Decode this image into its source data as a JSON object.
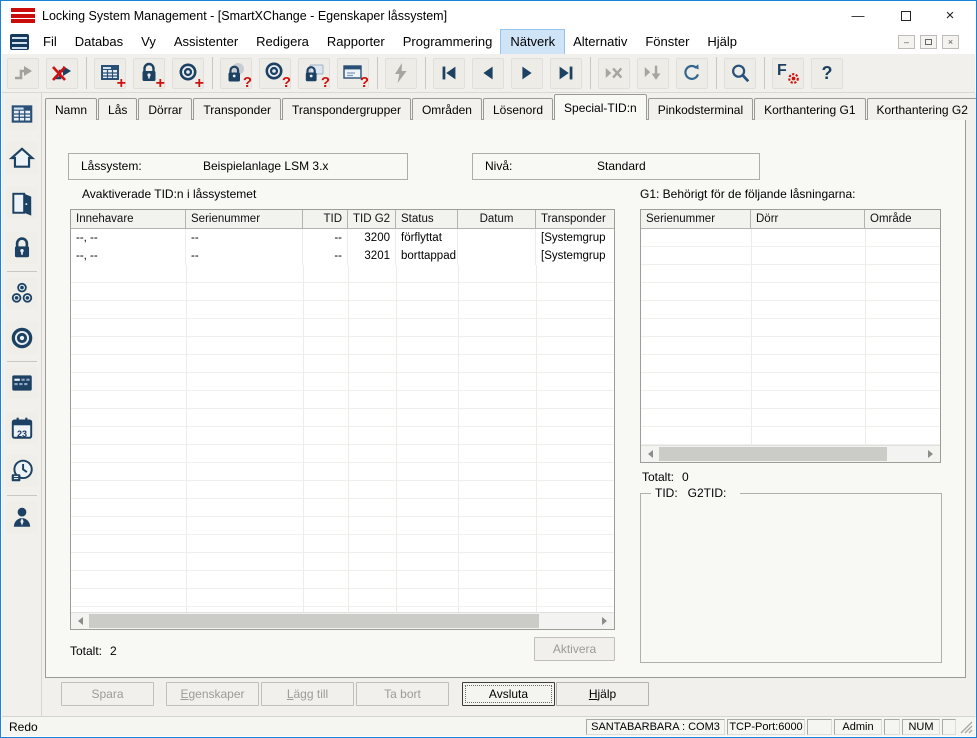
{
  "window": {
    "title": "Locking System Management - [SmartXChange - Egenskaper låssystem]",
    "minimize_glyph": "—",
    "close_glyph": "×"
  },
  "mdi": {
    "minimize_glyph": "–",
    "close_glyph": "×"
  },
  "menubar": {
    "items": [
      "Fil",
      "Databas",
      "Vy",
      "Assistenter",
      "Redigera",
      "Rapporter",
      "Programmering",
      "Nätverk",
      "Alternativ",
      "Fönster",
      "Hjälp"
    ],
    "active": "Nätverk"
  },
  "toolbar": {
    "buttons": [
      {
        "name": "jump",
        "overlay": ""
      },
      {
        "name": "jump-cancel",
        "overlay": ""
      },
      {
        "name": "new-locking-system",
        "overlay": "+"
      },
      {
        "name": "new-lock",
        "overlay": "+"
      },
      {
        "name": "new-transponder",
        "overlay": "+"
      },
      {
        "name": "read-lock",
        "overlay": "?"
      },
      {
        "name": "read-transponder",
        "overlay": "?"
      },
      {
        "name": "read-g1-lock",
        "overlay": "?"
      },
      {
        "name": "read-window",
        "overlay": "?"
      },
      {
        "name": "program",
        "overlay": ""
      },
      {
        "name": "first-record",
        "overlay": ""
      },
      {
        "name": "prev-record",
        "overlay": ""
      },
      {
        "name": "next-record",
        "overlay": ""
      },
      {
        "name": "last-record",
        "overlay": ""
      },
      {
        "name": "cancel-record",
        "overlay": ""
      },
      {
        "name": "goto-record",
        "overlay": ""
      },
      {
        "name": "refresh",
        "overlay": ""
      },
      {
        "name": "search",
        "overlay": ""
      },
      {
        "name": "filter-settings",
        "overlay": "",
        "base": "F"
      },
      {
        "name": "help",
        "overlay": "",
        "base": "?"
      }
    ]
  },
  "sidebar": {
    "icons": [
      "matrix",
      "home",
      "door",
      "lock",
      "transponder-group",
      "transponder",
      "schedule",
      "calendar",
      "time-zone",
      "user"
    ],
    "calendar_text": "23"
  },
  "tabs": {
    "items": [
      "Namn",
      "Lås",
      "Dörrar",
      "Transponder",
      "Transpondergrupper",
      "Områden",
      "Lösenord",
      "Special-TID:n",
      "Pinkodsterminal",
      "Korthantering G1",
      "Korthantering G2"
    ],
    "active": "Special-TID:n"
  },
  "form": {
    "locksystem_label": "Låssystem:",
    "locksystem_value": "Beispielanlage LSM 3.x",
    "level_label": "Nivå:",
    "level_value": "Standard"
  },
  "left_panel": {
    "caption": "Avaktiverade TID:n i låssystemet",
    "columns": [
      "Innehavare",
      "Serienummer",
      "TID",
      "TID G2",
      "Status",
      "Datum",
      "Transponder"
    ],
    "rows": [
      [
        "--, --",
        "--",
        "--",
        "3200",
        "förflyttat",
        "",
        "[Systemgrup"
      ],
      [
        "--, --",
        "--",
        "--",
        "3201",
        "borttappad",
        "",
        "[Systemgrup"
      ]
    ],
    "total_label": "Totalt:",
    "total_value": "2",
    "activate_button": "Aktivera"
  },
  "right_panel": {
    "caption": "G1: Behörigt för de följande låsningarna:",
    "columns": [
      "Serienummer",
      "Dörr",
      "Område"
    ],
    "total_label": "Totalt:",
    "total_value": "0",
    "group_tid_label": "TID:",
    "group_g2tid_label": "G2TID:"
  },
  "footer": {
    "buttons": [
      {
        "prefix": "",
        "rest": "Spara"
      },
      {
        "prefix": "E",
        "rest": "genskaper"
      },
      {
        "prefix": "L",
        "rest": "ägg till"
      },
      {
        "prefix": "",
        "rest": "Ta bort"
      },
      {
        "prefix": "",
        "rest": "Avsluta"
      },
      {
        "prefix": "H",
        "rest": "jälp"
      }
    ]
  },
  "statusbar": {
    "ready": "Redo",
    "com": "SANTABARBARA : COM3",
    "tcp": "TCP-Port:6000",
    "user": "Admin",
    "num": "NUM"
  },
  "colors": {
    "accent_blue": "#1a82d8",
    "icon_navy": "#1d4163",
    "accent_red": "#cf1110",
    "menu_highlight": "#cfe4f7"
  }
}
